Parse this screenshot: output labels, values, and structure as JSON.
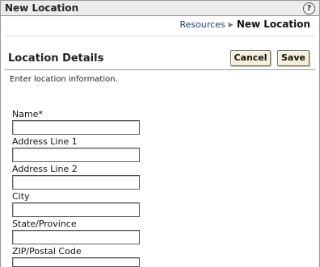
{
  "window": {
    "title": "New Location",
    "help_label": "?"
  },
  "breadcrumb": {
    "parent": "Resources",
    "separator": "▶",
    "current": "New Location"
  },
  "section": {
    "title": "Location Details",
    "cancel_label": "Cancel",
    "save_label": "Save",
    "instruction": "Enter location information."
  },
  "fields": [
    {
      "label": "Name*",
      "value": ""
    },
    {
      "label": "Address Line 1",
      "value": ""
    },
    {
      "label": "Address Line 2",
      "value": ""
    },
    {
      "label": "City",
      "value": ""
    },
    {
      "label": "State/Province",
      "value": ""
    },
    {
      "label": "ZIP/Postal Code",
      "value": ""
    }
  ]
}
